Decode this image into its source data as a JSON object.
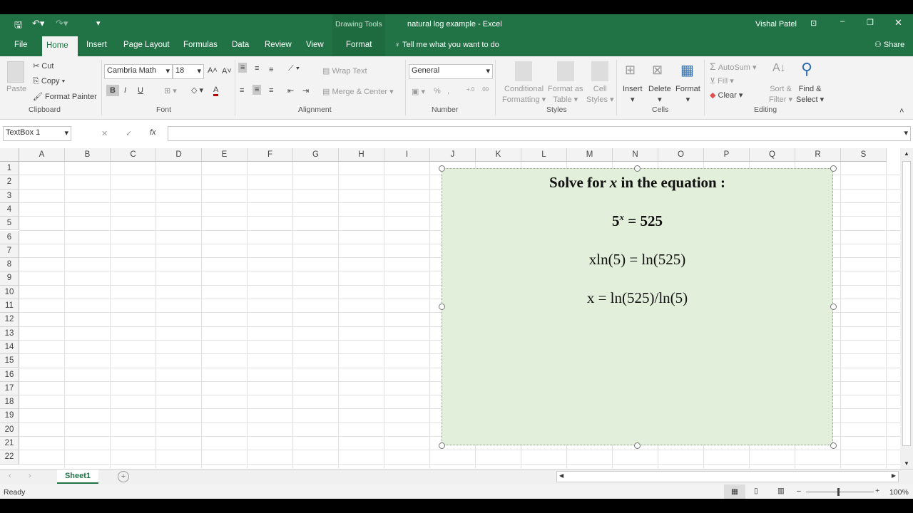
{
  "window": {
    "title": "natural log example  -  Excel",
    "context_tab": "Drawing Tools",
    "user": "Vishal Patel",
    "share": "Share"
  },
  "tabs": [
    "File",
    "Home",
    "Insert",
    "Page Layout",
    "Formulas",
    "Data",
    "Review",
    "View",
    "Format"
  ],
  "tell_me": "Tell me what you want to do",
  "ribbon": {
    "clipboard": {
      "paste": "Paste",
      "cut": "Cut",
      "copy": "Copy",
      "format_painter": "Format Painter",
      "label": "Clipboard"
    },
    "font": {
      "name": "Cambria Math",
      "size": "18",
      "bold": "B",
      "italic": "I",
      "underline": "U",
      "label": "Font",
      "font_color": "#c00000"
    },
    "alignment": {
      "wrap": "Wrap Text",
      "merge": "Merge & Center",
      "label": "Alignment"
    },
    "number": {
      "format": "General",
      "percent": "%",
      "label": "Number"
    },
    "styles": {
      "conditional": "Conditional",
      "conditional2": "Formatting",
      "format_table": "Format as",
      "format_table2": "Table",
      "cell_styles": "Cell",
      "cell_styles2": "Styles",
      "label": "Styles"
    },
    "cells": {
      "insert": "Insert",
      "delete": "Delete",
      "format": "Format",
      "label": "Cells"
    },
    "editing": {
      "autosum": "AutoSum",
      "fill": "Fill",
      "clear": "Clear",
      "sort": "Sort &",
      "sort2": "Filter",
      "find": "Find &",
      "find2": "Select",
      "label": "Editing"
    }
  },
  "formula_bar": {
    "name_box": "TextBox 1",
    "fx": "fx",
    "value": ""
  },
  "columns": [
    "A",
    "B",
    "C",
    "D",
    "E",
    "F",
    "G",
    "H",
    "I",
    "J",
    "K",
    "L",
    "M",
    "N",
    "O",
    "P",
    "Q",
    "R",
    "S"
  ],
  "rows": [
    "1",
    "2",
    "3",
    "4",
    "5",
    "6",
    "7",
    "8",
    "9",
    "10",
    "11",
    "12",
    "13",
    "14",
    "15",
    "16",
    "17",
    "18",
    "19",
    "20",
    "21",
    "22"
  ],
  "textbox": {
    "line1a": "Solve for ",
    "line1x": "x",
    "line1b": "  in the equation :",
    "line2base": "5",
    "line2exp": "x",
    "line2rest": " = 525",
    "line3": "xln(5) = ln(525)",
    "line4": "x = ln(525)/ln(5)",
    "fill": "#e2efda"
  },
  "sheets": [
    "Sheet1"
  ],
  "status": {
    "ready": "Ready",
    "zoom": "100%"
  },
  "accent": "#217346"
}
